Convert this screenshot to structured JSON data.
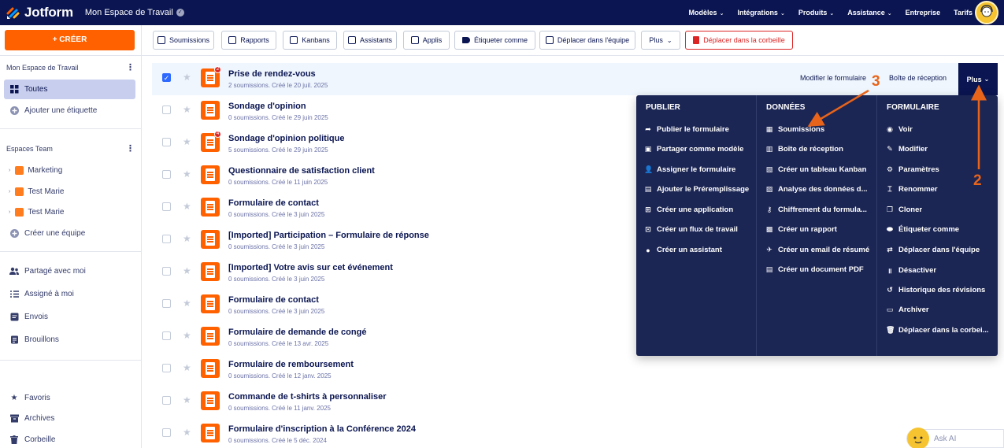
{
  "topbar": {
    "logo": "Jotform",
    "workspace": "Mon Espace de Travail",
    "nav": [
      {
        "label": "Modèles",
        "has_caret": true
      },
      {
        "label": "Intégrations",
        "has_caret": true
      },
      {
        "label": "Produits",
        "has_caret": true
      },
      {
        "label": "Assistance",
        "has_caret": true
      },
      {
        "label": "Entreprise",
        "has_caret": false
      },
      {
        "label": "Tarifs",
        "has_caret": false
      }
    ]
  },
  "sidebar": {
    "create_label": "+ CRÉER",
    "workspace_title": "Mon Espace de Travail",
    "all_label": "Toutes",
    "add_label": "Ajouter une étiquette",
    "teams_title": "Espaces Team",
    "teams": [
      "Marketing",
      "Test Marie",
      "Test Marie"
    ],
    "create_team": "Créer une équipe",
    "shared": [
      "Partagé avec moi",
      "Assigné à moi",
      "Envois",
      "Brouillons"
    ],
    "bottom": [
      "Favoris",
      "Archives",
      "Corbeille"
    ]
  },
  "toolbar": {
    "buttons": [
      "Soumissions",
      "Rapports",
      "Kanbans",
      "Assistants",
      "Applis",
      "Étiqueter comme",
      "Déplacer dans l'équipe",
      "Plus",
      "Déplacer dans la corbeille"
    ]
  },
  "forms": [
    {
      "title": "Prise de rendez-vous",
      "meta": "2 soumissions. Créé le 20 juil. 2025",
      "badge": "2",
      "selected": true
    },
    {
      "title": "Sondage d'opinion",
      "meta": "0 soumissions. Créé le 29 juin 2025",
      "badge": "",
      "selected": false
    },
    {
      "title": "Sondage d'opinion politique",
      "meta": "5 soumissions. Créé le 29 juin 2025",
      "badge": "4",
      "selected": false
    },
    {
      "title": "Questionnaire de satisfaction client",
      "meta": "0 soumissions. Créé le 11 juin 2025",
      "badge": "",
      "selected": false
    },
    {
      "title": "Formulaire de contact",
      "meta": "0 soumissions. Créé le 3 juin 2025",
      "badge": "",
      "selected": false
    },
    {
      "title": "[Imported] Participation – Formulaire de réponse",
      "meta": "0 soumissions. Créé le 3 juin 2025",
      "badge": "",
      "selected": false
    },
    {
      "title": "[Imported] Votre avis sur cet événement",
      "meta": "0 soumissions. Créé le 3 juin 2025",
      "badge": "",
      "selected": false
    },
    {
      "title": "Formulaire de contact",
      "meta": "0 soumissions. Créé le 3 juin 2025",
      "badge": "",
      "selected": false
    },
    {
      "title": "Formulaire de demande de congé",
      "meta": "0 soumissions. Créé le 13 avr. 2025",
      "badge": "",
      "selected": false
    },
    {
      "title": "Formulaire de remboursement",
      "meta": "0 soumissions. Créé le 12 janv. 2025",
      "badge": "",
      "selected": false
    },
    {
      "title": "Commande de t-shirts à personnaliser",
      "meta": "0 soumissions. Créé le 11 janv. 2025",
      "badge": "",
      "selected": false
    },
    {
      "title": "Formulaire d'inscription à la Conférence 2024",
      "meta": "0 soumissions. Créé le 5 déc. 2024",
      "badge": "",
      "selected": false
    }
  ],
  "row_actions": {
    "edit": "Modifier le formulaire",
    "inbox": "Boîte de réception",
    "more": "Plus"
  },
  "dropdown": {
    "publier": {
      "title": "PUBLIER",
      "items": [
        {
          "label": "Publier le formulaire",
          "icon": "share-icon"
        },
        {
          "label": "Partager comme modèle",
          "icon": "template-icon"
        },
        {
          "label": "Assigner le formulaire",
          "icon": "assign-icon"
        },
        {
          "label": "Ajouter le Préremplissage",
          "icon": "prefill-icon"
        },
        {
          "label": "Créer une application",
          "icon": "app-icon"
        },
        {
          "label": "Créer un flux de travail",
          "icon": "workflow-icon"
        },
        {
          "label": "Créer un assistant",
          "icon": "agent-icon"
        }
      ]
    },
    "donnees": {
      "title": "DONNÉES",
      "items": [
        {
          "label": "Soumissions",
          "icon": "table-icon"
        },
        {
          "label": "Boîte de réception",
          "icon": "inbox-icon"
        },
        {
          "label": "Créer un tableau Kanban",
          "icon": "kanban-icon"
        },
        {
          "label": "Analyse des données d...",
          "icon": "analysis-icon"
        },
        {
          "label": "Chiffrement du formula...",
          "icon": "key-icon"
        },
        {
          "label": "Créer un rapport",
          "icon": "report-icon"
        },
        {
          "label": "Créer un email de résumé",
          "icon": "email-icon"
        },
        {
          "label": "Créer un document PDF",
          "icon": "pdf-icon"
        }
      ]
    },
    "formulaire": {
      "title": "FORMULAIRE",
      "items": [
        {
          "label": "Voir",
          "icon": "eye-icon"
        },
        {
          "label": "Modifier",
          "icon": "edit-icon"
        },
        {
          "label": "Paramètres",
          "icon": "gear-icon"
        },
        {
          "label": "Renommer",
          "icon": "rename-icon"
        },
        {
          "label": "Cloner",
          "icon": "clone-icon"
        },
        {
          "label": "Étiqueter comme",
          "icon": "label-icon"
        },
        {
          "label": "Déplacer dans l'équipe",
          "icon": "move-team-icon"
        },
        {
          "label": "Désactiver",
          "icon": "pause-icon"
        },
        {
          "label": "Historique des révisions",
          "icon": "history-icon"
        },
        {
          "label": "Archiver",
          "icon": "archive-icon"
        },
        {
          "label": "Déplacer dans la corbei...",
          "icon": "trash-icon"
        }
      ]
    }
  },
  "annotations": {
    "step_2": "2",
    "step_3": "3"
  },
  "askai": "Ask AI",
  "colors": {
    "brand_navy": "#0a1551",
    "accent_orange": "#ff6100",
    "danger": "#dc2626",
    "annotation": "#e8641a"
  }
}
